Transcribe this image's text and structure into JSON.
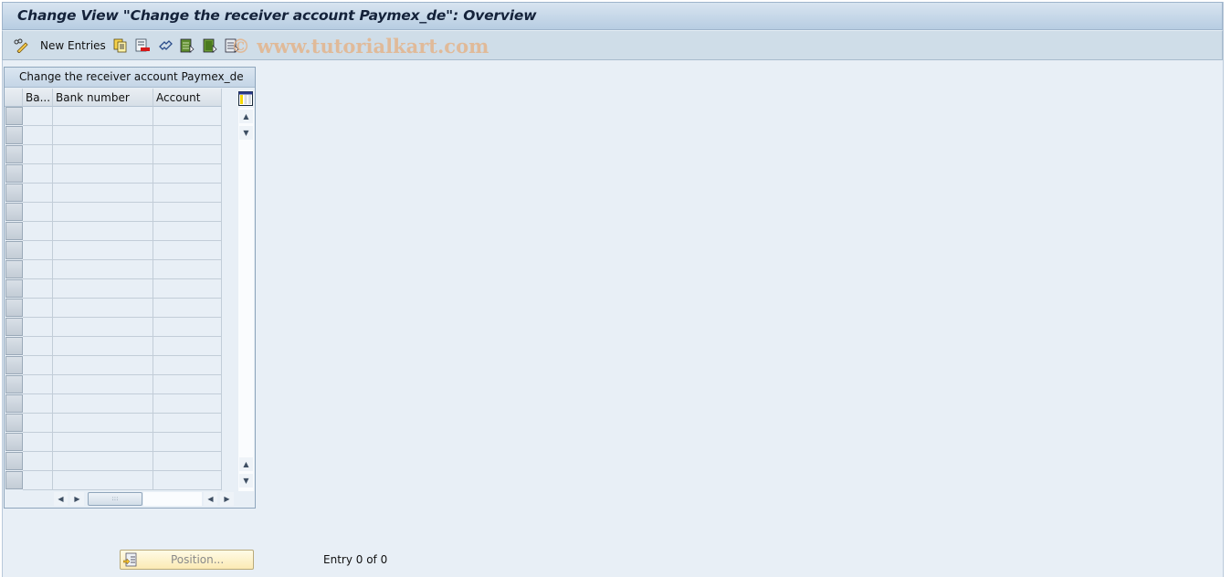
{
  "window": {
    "title": "Change View \"Change the receiver account Paymex_de\": Overview"
  },
  "toolbar": {
    "items": [
      {
        "name": "display-change-icon",
        "label": ""
      },
      {
        "name": "new-entries-button",
        "label": "New Entries"
      },
      {
        "name": "copy-as-icon",
        "label": ""
      },
      {
        "name": "delete-icon",
        "label": ""
      },
      {
        "name": "undo-change-icon",
        "label": ""
      },
      {
        "name": "select-all-icon",
        "label": ""
      },
      {
        "name": "select-block-icon",
        "label": ""
      },
      {
        "name": "deselect-all-icon",
        "label": ""
      }
    ],
    "new_entries_label": "New Entries",
    "watermark": "© www.tutorialkart.com"
  },
  "table": {
    "title": "Change the receiver account Paymex_de",
    "columns": [
      {
        "label": "Ba..."
      },
      {
        "label": "Bank number"
      },
      {
        "label": "Account"
      }
    ],
    "row_count_visible": 20,
    "rows": []
  },
  "footer": {
    "position_button_label": "Position...",
    "entry_status": "Entry 0 of 0"
  },
  "colors": {
    "background": "#e8eff6",
    "titlebar": "#b7cde2",
    "toolbar": "#cfdde8",
    "watermark": "#eaa86e",
    "position_button": "#fbeab4"
  }
}
